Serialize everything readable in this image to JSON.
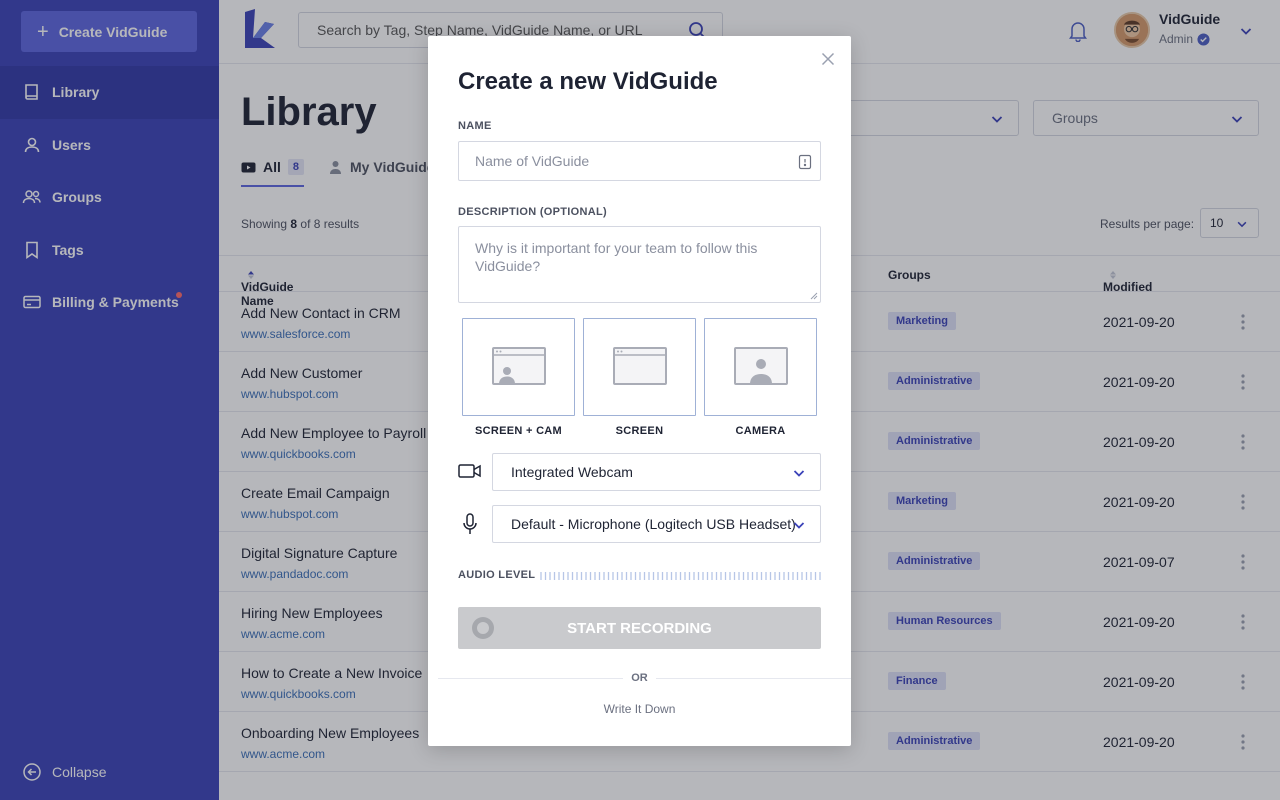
{
  "sidebar": {
    "create_label": "Create VidGuide",
    "items": [
      {
        "label": "Library",
        "icon": "book-icon"
      },
      {
        "label": "Users",
        "icon": "user-icon"
      },
      {
        "label": "Groups",
        "icon": "users-group-icon"
      },
      {
        "label": "Tags",
        "icon": "bookmark-icon"
      },
      {
        "label": "Billing & Payments",
        "icon": "credit-card-icon"
      }
    ],
    "collapse_label": "Collapse"
  },
  "header": {
    "search_placeholder": "Search by Tag, Step Name, VidGuide Name, or URL",
    "user_name": "VidGuide",
    "user_role": "Admin"
  },
  "library": {
    "title": "Library",
    "tab_all": "All",
    "tab_all_count": "8",
    "tab_mine": "My VidGuides",
    "groups_filter": "Groups",
    "showing_prefix": "Showing ",
    "showing_count": "8",
    "showing_suffix": " of 8 results",
    "rpp_label": "Results per page:",
    "rpp_value": "10",
    "columns": {
      "name": "VidGuide Name",
      "groups": "Groups",
      "modified": "Modified"
    },
    "rows": [
      {
        "name": "Add New Contact in CRM",
        "url": "www.salesforce.com",
        "group": "Marketing",
        "date": "2021-09-20"
      },
      {
        "name": "Add New Customer",
        "url": "www.hubspot.com",
        "group": "Administrative",
        "date": "2021-09-20"
      },
      {
        "name": "Add New Employee to Payroll",
        "url": "www.quickbooks.com",
        "group": "Administrative",
        "date": "2021-09-20"
      },
      {
        "name": "Create Email Campaign",
        "url": "www.hubspot.com",
        "group": "Marketing",
        "date": "2021-09-20"
      },
      {
        "name": "Digital Signature Capture",
        "url": "www.pandadoc.com",
        "group": "Administrative",
        "date": "2021-09-07"
      },
      {
        "name": "Hiring New Employees",
        "url": "www.acme.com",
        "group": "Human Resources",
        "date": "2021-09-20"
      },
      {
        "name": "How to Create a New Invoice",
        "url": "www.quickbooks.com",
        "group": "Finance",
        "date": "2021-09-20"
      },
      {
        "name": "Onboarding New Employees",
        "url": "www.acme.com",
        "group": "Administrative",
        "date": "2021-09-20"
      }
    ]
  },
  "modal": {
    "title": "Create a new VidGuide",
    "name_label": "NAME",
    "name_placeholder": "Name of VidGuide",
    "desc_label": "DESCRIPTION (OPTIONAL)",
    "desc_placeholder": "Why is it important for your team to follow this VidGuide?",
    "modes": [
      "SCREEN + CAM",
      "SCREEN",
      "CAMERA"
    ],
    "camera_value": "Integrated Webcam",
    "mic_value": "Default - Microphone (Logitech USB Headset)",
    "audio_label": "AUDIO LEVEL",
    "start_label": "START RECORDING",
    "or_label": "OR",
    "write_label": "Write It Down"
  },
  "colors": {
    "sidebar": "#3b42b8",
    "accent": "#5d66e0",
    "group_badge_bg": "#dfe2f8",
    "start_disabled": "#c9cacd"
  }
}
